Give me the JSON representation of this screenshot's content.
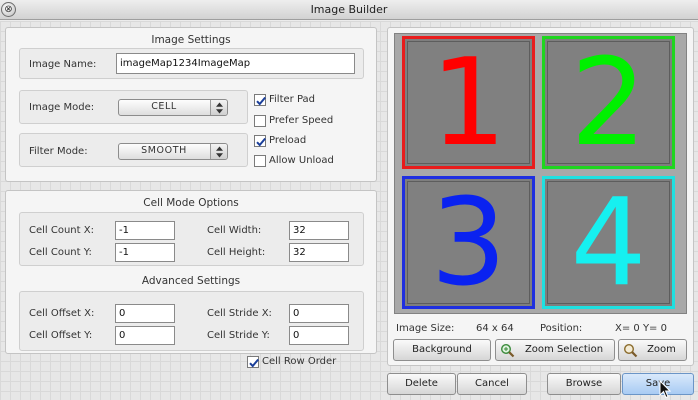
{
  "window": {
    "title": "Image Builder",
    "close_glyph": "⊗"
  },
  "image_settings": {
    "title": "Image Settings",
    "image_name_label": "Image Name:",
    "image_name_value": "imageMap1234ImageMap",
    "image_mode_label": "Image Mode:",
    "image_mode_value": "CELL",
    "filter_mode_label": "Filter Mode:",
    "filter_mode_value": "SMOOTH",
    "checkboxes": [
      {
        "label": "Filter Pad",
        "checked": true
      },
      {
        "label": "Prefer Speed",
        "checked": false
      },
      {
        "label": "Preload",
        "checked": true
      },
      {
        "label": "Allow Unload",
        "checked": false
      }
    ]
  },
  "cell_mode": {
    "title": "Cell Mode Options",
    "cell_count_x_label": "Cell Count X:",
    "cell_count_x": "-1",
    "cell_count_y_label": "Cell Count Y:",
    "cell_count_y": "-1",
    "cell_width_label": "Cell Width:",
    "cell_width": "32",
    "cell_height_label": "Cell Height:",
    "cell_height": "32"
  },
  "advanced": {
    "title": "Advanced Settings",
    "offset_x_label": "Cell Offset X:",
    "offset_x": "0",
    "offset_y_label": "Cell Offset Y:",
    "offset_y": "0",
    "stride_x_label": "Cell Stride X:",
    "stride_x": "0",
    "stride_y_label": "Cell Stride Y:",
    "stride_y": "0",
    "row_order_label": "Cell Row Order",
    "row_order_checked": true
  },
  "preview": {
    "tiles": [
      {
        "digit": "1",
        "color": "#ff0000",
        "border": "#e81c1c"
      },
      {
        "digit": "2",
        "color": "#00f000",
        "border": "#1fd61f"
      },
      {
        "digit": "3",
        "color": "#0a22f0",
        "border": "#1f2fe0"
      },
      {
        "digit": "4",
        "color": "#16f0f0",
        "border": "#1fe0e0"
      }
    ],
    "image_size_label": "Image Size:",
    "image_size_value": "64 x 64",
    "position_label": "Position:",
    "position_value": "X= 0  Y= 0",
    "background_button": "Background",
    "zoom_selection_button": "Zoom Selection",
    "zoom_button": "Zoom"
  },
  "footer": {
    "delete": "Delete",
    "cancel": "Cancel",
    "browse": "Browse",
    "save": "Save"
  },
  "icons": {
    "zoom_selection": "zoom-selection-icon",
    "zoom": "magnifier-icon",
    "combo_arrows": "up-down-arrows-icon",
    "checkmark": "checkmark-icon",
    "cursor": "mouse-pointer-icon"
  },
  "colors": {
    "primary_button": "#a8cbf3",
    "preview_background": "#a8a8a8"
  }
}
